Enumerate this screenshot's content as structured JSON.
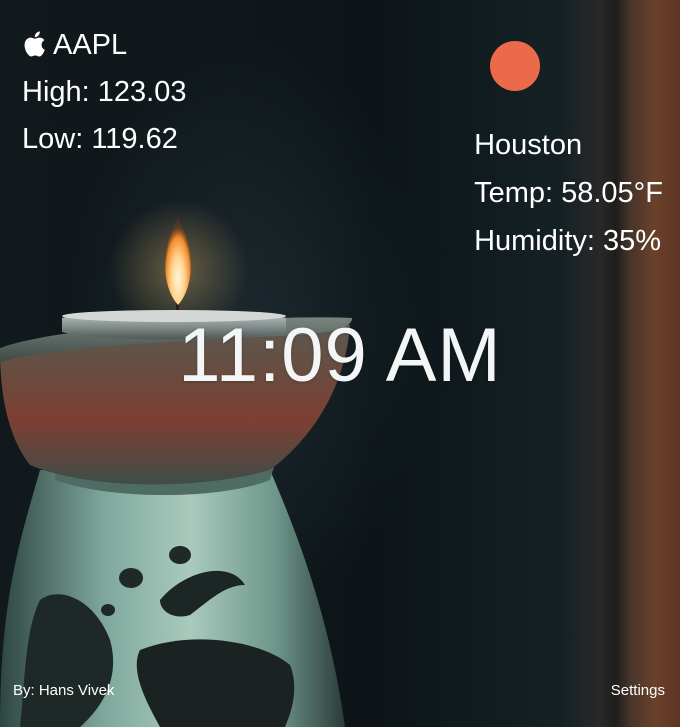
{
  "stock": {
    "symbol": "AAPL",
    "icon": "apple-icon",
    "high_label": "High: 123.03",
    "low_label": "Low: 119.62"
  },
  "weather": {
    "icon": "sun-icon",
    "icon_color": "#ec6a4c",
    "city": "Houston",
    "temp_label": "Temp: 58.05°F",
    "humidity_label": "Humidity: 35%"
  },
  "clock": {
    "time": "11:09 AM"
  },
  "footer": {
    "credit": "By: Hans Vivek",
    "settings_label": "Settings"
  }
}
